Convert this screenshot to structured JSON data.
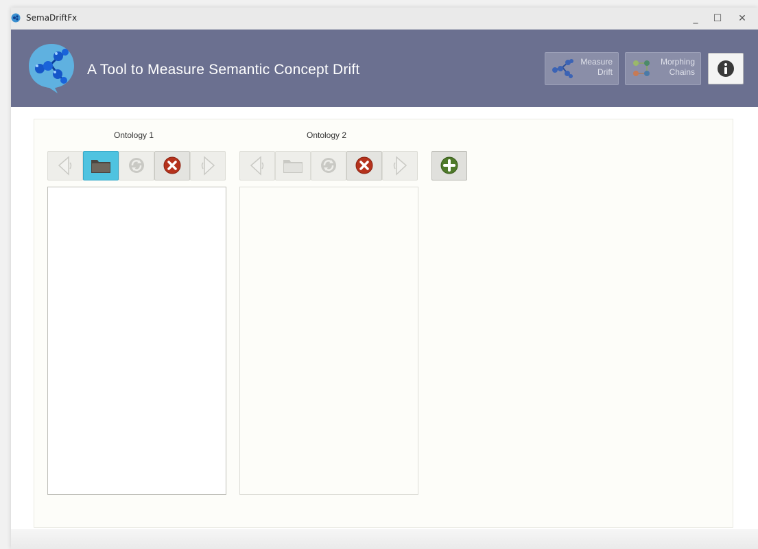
{
  "window": {
    "title": "SemaDriftFx",
    "controls": {
      "minimize": "_",
      "maximize": "☐",
      "close": "✕"
    }
  },
  "header": {
    "title": "A Tool to Measure Semantic Concept Drift",
    "buttons": {
      "measure_line1": "Measure",
      "measure_line2": "Drift",
      "morph_line1": "Morphing",
      "morph_line2": "Chains"
    }
  },
  "ontology1": {
    "label": "Ontology 1",
    "toolbar": [
      "previous",
      "open-folder",
      "refresh",
      "delete",
      "next"
    ],
    "active_button": "open-folder",
    "items": []
  },
  "ontology2": {
    "label": "Ontology 2",
    "toolbar": [
      "previous",
      "open-folder",
      "refresh",
      "delete",
      "next"
    ],
    "items": []
  },
  "colors": {
    "header_bg": "#6b7090",
    "active_button": "#4fc3e0",
    "delete_red": "#b5321c",
    "add_green": "#4f7a2a"
  }
}
